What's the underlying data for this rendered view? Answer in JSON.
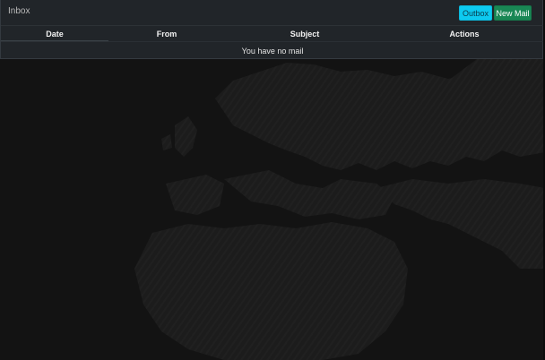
{
  "panel": {
    "title": "Inbox",
    "buttons": {
      "outbox_label": "Outbox",
      "new_mail_label": "New Mail"
    }
  },
  "table": {
    "columns": [
      "Date",
      "From",
      "Subject",
      "Actions"
    ],
    "empty_message": "You have no mail"
  },
  "colors": {
    "background": "#131313",
    "panel": "#212529",
    "outbox_button": "#0dcaf0",
    "new_mail_button": "#198754",
    "map_land": "#1d1d1d"
  },
  "icons": {
    "background": "world-map-background"
  }
}
